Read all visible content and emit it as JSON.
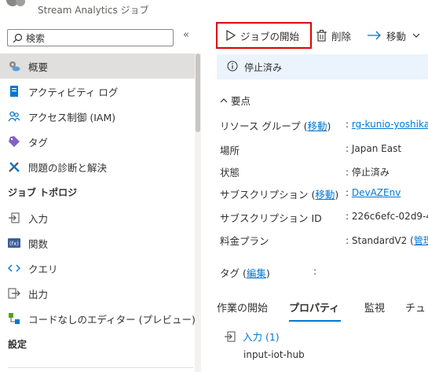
{
  "header": {
    "subtitle": "Stream Analytics ジョブ"
  },
  "sidebar": {
    "search_placeholder": "検索",
    "collapse_glyph": "«",
    "items": [
      {
        "label": "概要",
        "icon": "gear-cloud-icon",
        "selected": true
      },
      {
        "label": "アクティビティ ログ",
        "icon": "activity-log-icon"
      },
      {
        "label": "アクセス制御 (IAM)",
        "icon": "people-icon"
      },
      {
        "label": "タグ",
        "icon": "tag-icon"
      },
      {
        "label": "問題の診断と解決",
        "icon": "wrench-icon"
      }
    ],
    "section_topology": "ジョブ トポロジ",
    "topology_items": [
      {
        "label": "入力",
        "icon": "input-icon"
      },
      {
        "label": "関数",
        "icon": "function-icon"
      },
      {
        "label": "クエリ",
        "icon": "query-icon"
      },
      {
        "label": "出力",
        "icon": "output-icon"
      },
      {
        "label": "コードなしのエディター (プレビュー)",
        "icon": "no-code-editor-icon"
      }
    ],
    "section_settings": "設定"
  },
  "toolbar": {
    "start_label": "ジョブの開始",
    "delete_label": "削除",
    "move_label": "移動"
  },
  "banner": {
    "text": "停止済み"
  },
  "essentials": {
    "label": "要点",
    "rows": [
      {
        "key": "リソース グループ (",
        "link": "移動",
        "key_end": ")",
        "value": "rg-kunio-yoshika",
        "value_link": true
      },
      {
        "key": "場所",
        "value": "Japan East"
      },
      {
        "key": "状態",
        "value": "停止済み"
      },
      {
        "key": "サブスクリプション (",
        "link": "移動",
        "key_end": ")",
        "value": "DevAZEnv",
        "value_link": true
      },
      {
        "key": "サブスクリプション ID",
        "value": "226c6efc-02d9-4"
      },
      {
        "key": "料金プラン",
        "value": "StandardV2 (",
        "value_suffix": "管理"
      }
    ],
    "tags_key": "タグ (",
    "tags_link": "編集",
    "tags_end": ")",
    "separator": ":"
  },
  "tabs": [
    "作業の開始",
    "プロパティ",
    "監視",
    "チュ"
  ],
  "inputs": {
    "header": "入力 (1)",
    "items": [
      "input-iot-hub"
    ]
  },
  "colors": {
    "accent": "#0078d4",
    "highlight_border": "#e00000",
    "banner_bg": "#ebf3fc",
    "selected_bg": "#e1dfdd"
  }
}
